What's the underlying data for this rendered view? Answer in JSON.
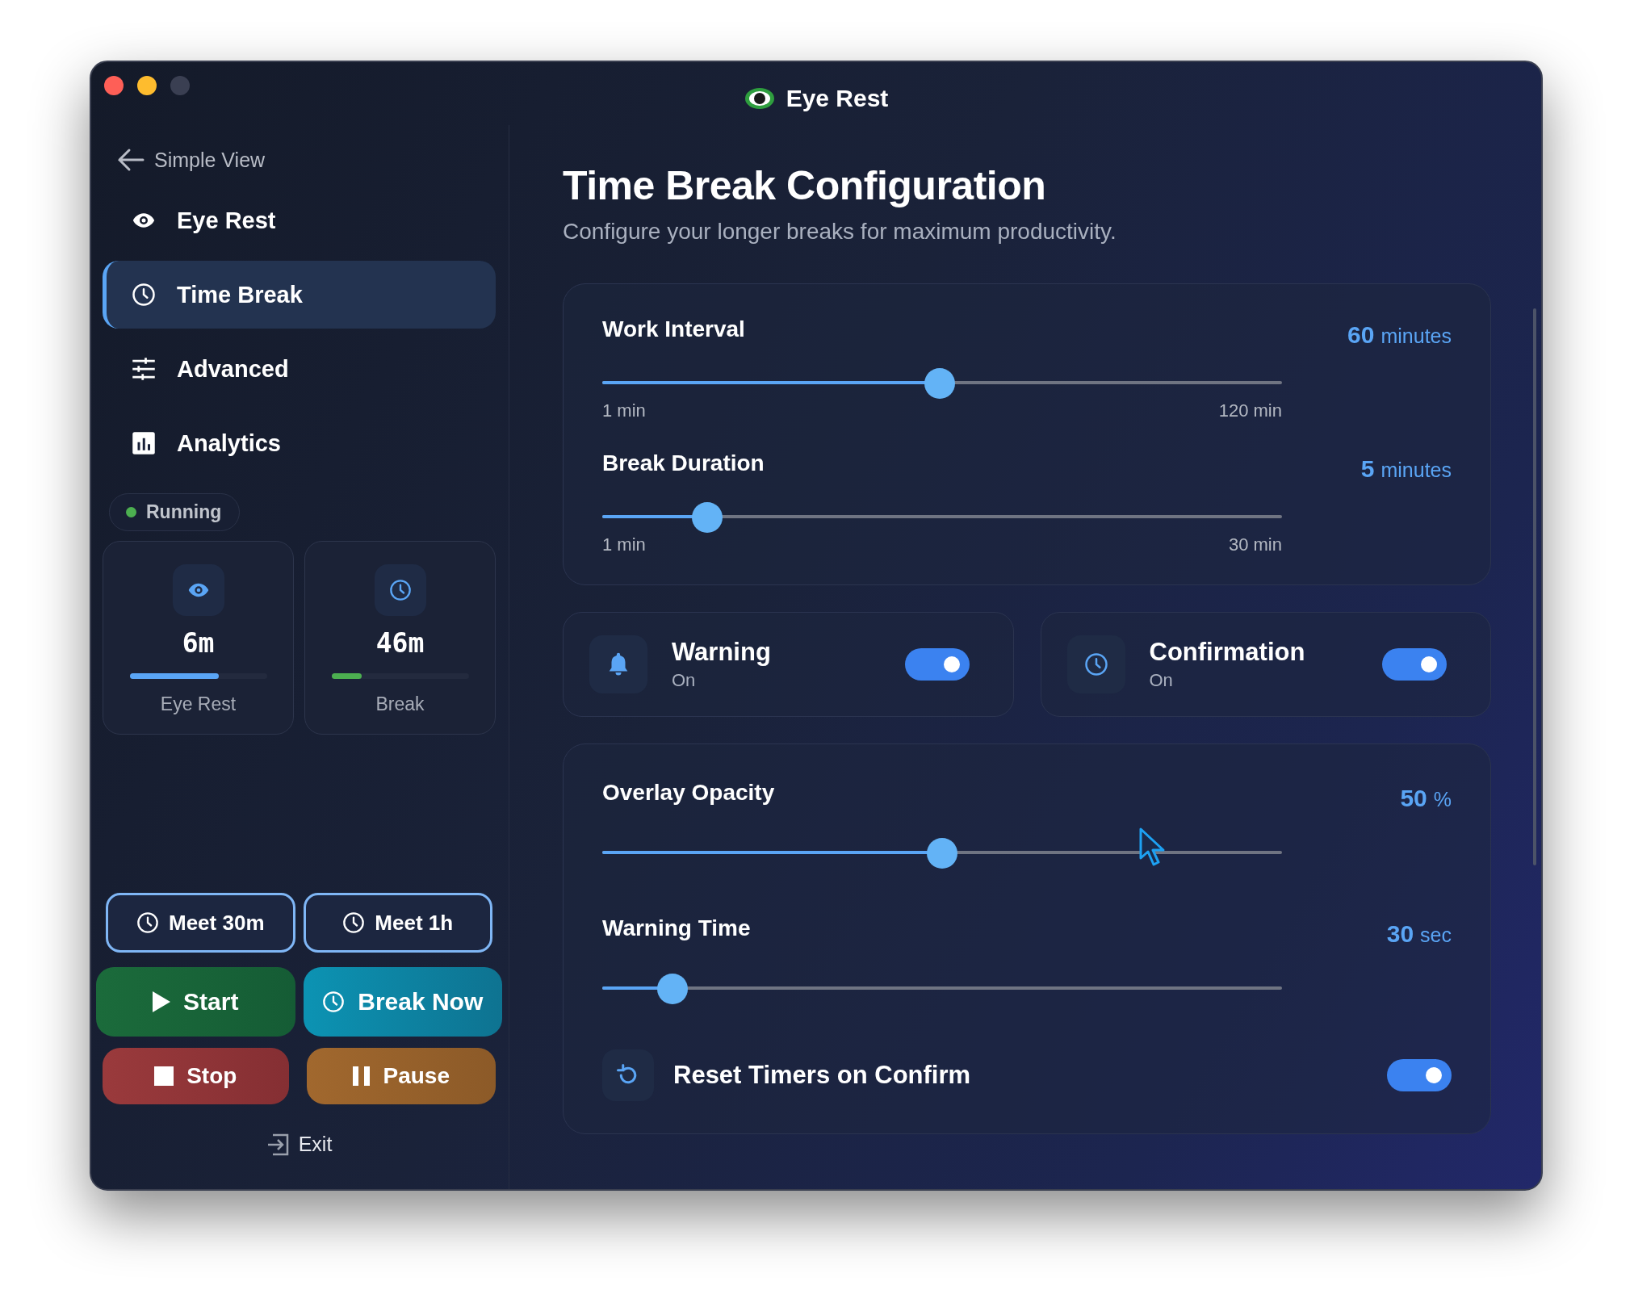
{
  "window": {
    "title": "Eye Rest"
  },
  "sidebar": {
    "back_link": "Simple View",
    "items": [
      {
        "label": "Eye Rest",
        "kind": "eye",
        "selected": false
      },
      {
        "label": "Time Break",
        "kind": "clock",
        "selected": true
      },
      {
        "label": "Advanced",
        "kind": "sliders",
        "selected": false
      },
      {
        "label": "Analytics",
        "kind": "chart",
        "selected": false
      }
    ],
    "status": {
      "label": "Running",
      "color": "#4caf50"
    },
    "timers": [
      {
        "kind": "eye",
        "value": "6m",
        "label": "Eye Rest",
        "level": 0.65,
        "color": "#5aa5f5"
      },
      {
        "kind": "clock",
        "value": "46m",
        "label": "Break",
        "level": 0.22,
        "color": "#4caf50"
      }
    ],
    "meeting_buttons": [
      "Meet 30m",
      "Meet 1h"
    ],
    "actions": [
      {
        "label": "Start",
        "kind": "start"
      },
      {
        "label": "Break Now",
        "kind": "break"
      },
      {
        "label": "Stop",
        "kind": "stop"
      },
      {
        "label": "Pause",
        "kind": "pause"
      }
    ],
    "exit": "Exit"
  },
  "main": {
    "title": "Time Break Configuration",
    "subtitle": "Configure your longer breaks for maximum productivity.",
    "timing_card": {
      "sliders": [
        {
          "label": "Work Interval",
          "value": "60",
          "unit": "minutes",
          "level": 0.496,
          "min_label": "1 min",
          "max_label": "120 min"
        },
        {
          "label": "Break Duration",
          "value": "5",
          "unit": "minutes",
          "level": 0.154,
          "min_label": "1 min",
          "max_label": "30 min"
        }
      ]
    },
    "toggles": [
      {
        "kind": "bell",
        "label": "Warning",
        "status": "On",
        "on": true
      },
      {
        "kind": "clock",
        "label": "Confirmation",
        "status": "On",
        "on": true
      }
    ],
    "overlay_card": {
      "sliders": [
        {
          "label": "Overlay Opacity",
          "value": "50",
          "unit": "%",
          "level": 0.5
        },
        {
          "label": "Warning Time",
          "value": "30",
          "unit": "sec",
          "level": 0.103
        }
      ],
      "reset": {
        "label": "Reset Timers on Confirm",
        "on": true
      }
    }
  }
}
